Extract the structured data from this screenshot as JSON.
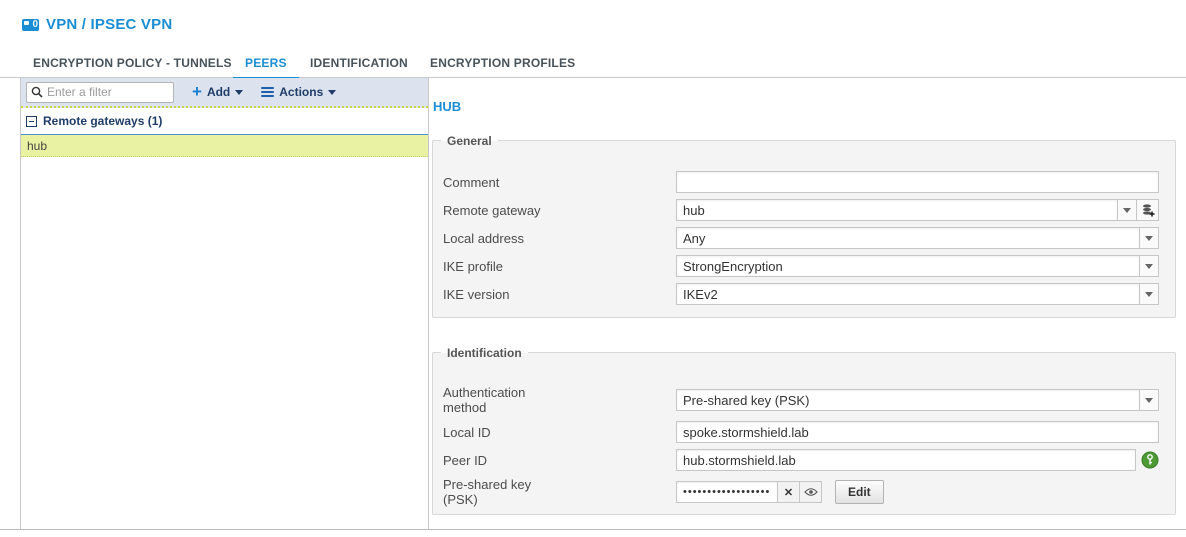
{
  "header": {
    "title": "VPN / IPSEC VPN"
  },
  "tabs": [
    {
      "label": "ENCRYPTION POLICY - TUNNELS",
      "active": false
    },
    {
      "label": "PEERS",
      "active": true
    },
    {
      "label": "IDENTIFICATION",
      "active": false
    },
    {
      "label": "ENCRYPTION PROFILES",
      "active": false
    }
  ],
  "toolbar": {
    "filter_placeholder": "Enter a filter",
    "add_label": "Add",
    "actions_label": "Actions"
  },
  "tree": {
    "group_label": "Remote gateways (1)",
    "items": [
      {
        "label": "hub",
        "selected": true
      }
    ]
  },
  "detail": {
    "title": "HUB",
    "general": {
      "legend": "General",
      "fields": {
        "comment": {
          "label": "Comment",
          "value": ""
        },
        "remote_gateway": {
          "label": "Remote gateway",
          "value": "hub"
        },
        "local_address": {
          "label": "Local address",
          "value": "Any"
        },
        "ike_profile": {
          "label": "IKE profile",
          "value": "StrongEncryption"
        },
        "ike_version": {
          "label": "IKE version",
          "value": "IKEv2"
        }
      }
    },
    "identification": {
      "legend": "Identification",
      "fields": {
        "auth_method": {
          "label": "Authentication method",
          "value": "Pre-shared key (PSK)"
        },
        "local_id": {
          "label": "Local ID",
          "value": "spoke.stormshield.lab"
        },
        "peer_id": {
          "label": "Peer ID",
          "value": "hub.stormshield.lab"
        },
        "psk": {
          "label": "Pre-shared key (PSK)",
          "value": "••••••••••••••••••••",
          "clear_glyph": "✕",
          "edit_label": "Edit"
        }
      }
    }
  },
  "colors": {
    "accent": "#1b8ed3",
    "navy": "#1f3d68",
    "selection": "#e9f2a2",
    "toolbar_bg": "#dce3ee",
    "key_icon_green": "#4e9b35"
  }
}
